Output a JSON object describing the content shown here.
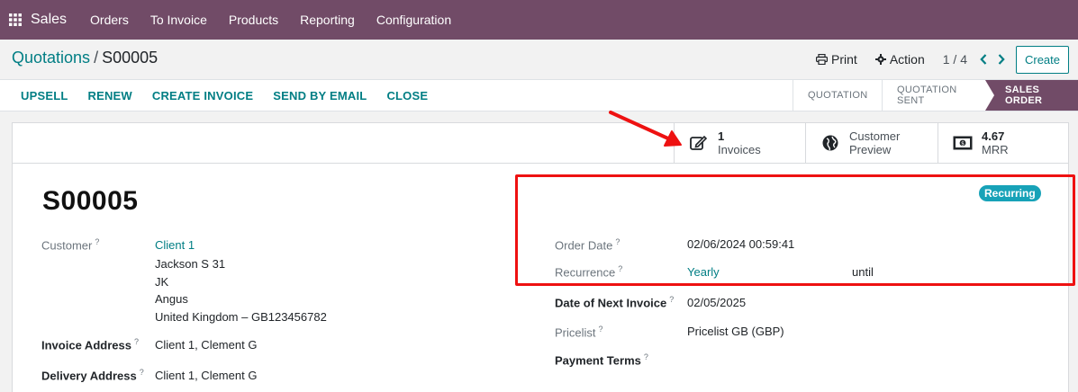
{
  "navbar": {
    "brand": "Sales",
    "menu": [
      "Orders",
      "To Invoice",
      "Products",
      "Reporting",
      "Configuration"
    ],
    "bg_color": "#714b67"
  },
  "breadcrumb": {
    "parent": "Quotations",
    "separator": "/",
    "current": "S00005"
  },
  "control": {
    "print_label": "Print",
    "action_label": "Action",
    "pager": "1 / 4",
    "create_label": "Create"
  },
  "statusbar": {
    "buttons": [
      "UPSELL",
      "RENEW",
      "CREATE INVOICE",
      "SEND BY EMAIL",
      "CLOSE"
    ],
    "stages": [
      "QUOTATION",
      "QUOTATION SENT",
      "SALES ORDER"
    ],
    "active_stage": "SALES ORDER"
  },
  "smart_buttons": {
    "invoices": {
      "count": "1",
      "label": "Invoices",
      "icon": "edit-icon"
    },
    "preview": {
      "line1": "Customer",
      "line2": "Preview",
      "icon": "globe-icon"
    },
    "mrr": {
      "value": "4.67",
      "label": "MRR",
      "icon": "money-icon"
    }
  },
  "order": {
    "name": "S00005",
    "badge": "Recurring",
    "customer_label": "Customer",
    "customer_name": "Client 1",
    "address_lines": [
      "Jackson S 31",
      "JK",
      "Angus",
      "United Kingdom – GB123456782"
    ],
    "invoice_address_label": "Invoice Address",
    "invoice_address": "Client 1, Clement G",
    "delivery_address_label": "Delivery Address",
    "delivery_address": "Client 1, Clement G",
    "order_date_label": "Order Date",
    "order_date": "02/06/2024 00:59:41",
    "recurrence_label": "Recurrence",
    "recurrence": "Yearly",
    "until_label": "until",
    "next_invoice_label": "Date of Next Invoice",
    "next_invoice": "02/05/2025",
    "pricelist_label": "Pricelist",
    "pricelist": "Pricelist GB (GBP)",
    "payment_terms_label": "Payment Terms",
    "help_mark": "?"
  },
  "colors": {
    "accent": "#017e84",
    "annotation": "#ee1111",
    "badge": "#17a2b8"
  }
}
